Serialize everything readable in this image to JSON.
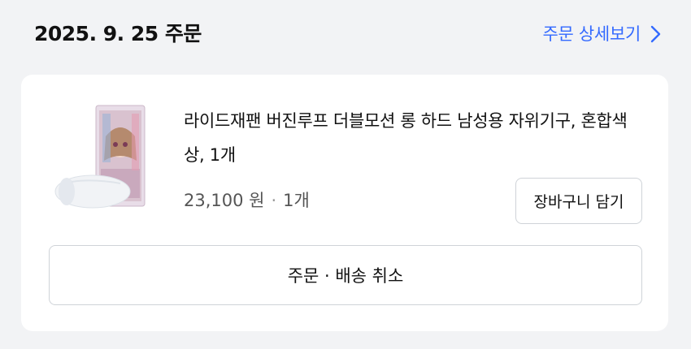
{
  "order": {
    "date_title": "2025. 9. 25 주문",
    "detail_link_label": "주문 상세보기",
    "detail_link_icon": "chevron-right-icon",
    "accent_color": "#346aff"
  },
  "item": {
    "name": "라이드재팬 버진루프 더블모션 롱 하드 남성용 자위기구, 혼합색상, 1개",
    "price": "23,100 원",
    "separator": "·",
    "quantity": "1개",
    "image": "product-thumbnail"
  },
  "actions": {
    "add_to_cart_label": "장바구니 담기",
    "cancel_label": "주문 · 배송 취소"
  }
}
